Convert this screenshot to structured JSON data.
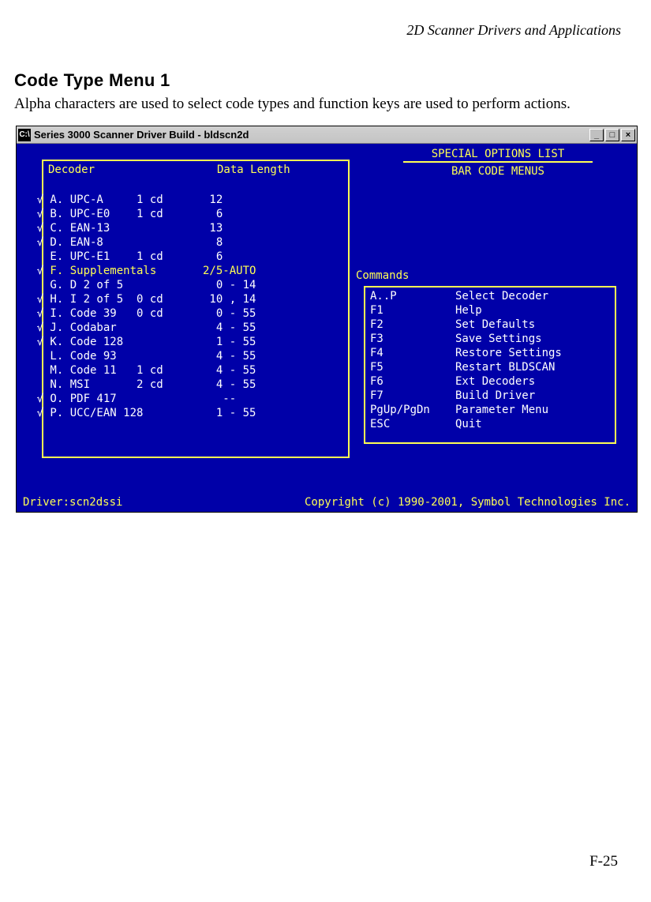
{
  "page": {
    "running_head": "2D Scanner Drivers and Applications",
    "section_title": "Code Type Menu 1",
    "intro": "Alpha characters are used to select code types and function keys are used to perform actions.",
    "page_number": "F-25"
  },
  "window": {
    "sys_icon": "C:\\",
    "title": "Series 3000 Scanner Driver Build - bldscn2d",
    "min_label": "_",
    "max_label": "□",
    "close_label": "×"
  },
  "screen": {
    "opt_title": "SPECIAL OPTIONS LIST",
    "opt_sub": "BAR CODE MENUS",
    "decoder_header_1": "Decoder",
    "decoder_header_2": "Data Length",
    "commands_label": "Commands",
    "driver_label": "Driver:",
    "driver_name": "scn2dssi",
    "copyright": "Copyright (c) 1990-2001, Symbol Technologies Inc."
  },
  "decoders": [
    {
      "ck": "√",
      "name": "A. UPC-A     1 cd",
      "len": " 12"
    },
    {
      "ck": "√",
      "name": "B. UPC-E0    1 cd",
      "len": "  6"
    },
    {
      "ck": "√",
      "name": "C. EAN-13",
      "len": " 13"
    },
    {
      "ck": "√",
      "name": "D. EAN-8",
      "len": "  8"
    },
    {
      "ck": " ",
      "name": "E. UPC-E1    1 cd",
      "len": "  6"
    },
    {
      "ck": "√",
      "name": "F. Supplementals",
      "len": "2/5-AUTO",
      "yellow": true
    },
    {
      "ck": " ",
      "name": "G. D 2 of 5",
      "len": "  0 - 14"
    },
    {
      "ck": "√",
      "name": "H. I 2 of 5  0 cd",
      "len": " 10 , 14"
    },
    {
      "ck": "√",
      "name": "I. Code 39   0 cd",
      "len": "  0 - 55"
    },
    {
      "ck": "√",
      "name": "J. Codabar",
      "len": "  4 - 55"
    },
    {
      "ck": "√",
      "name": "K. Code 128",
      "len": "  1 - 55"
    },
    {
      "ck": " ",
      "name": "L. Code 93",
      "len": "  4 - 55"
    },
    {
      "ck": " ",
      "name": "M. Code 11   1 cd",
      "len": "  4 - 55"
    },
    {
      "ck": " ",
      "name": "N. MSI       2 cd",
      "len": "  4 - 55"
    },
    {
      "ck": "√",
      "name": "O. PDF 417",
      "len": "   --"
    },
    {
      "ck": "√",
      "name": "P. UCC/EAN 128",
      "len": "  1 - 55"
    }
  ],
  "commands": [
    {
      "key": "A..P",
      "action": "Select Decoder"
    },
    {
      "key": "F1",
      "action": "Help"
    },
    {
      "key": "F2",
      "action": "Set Defaults"
    },
    {
      "key": "F3",
      "action": "Save Settings"
    },
    {
      "key": "F4",
      "action": "Restore Settings"
    },
    {
      "key": "F5",
      "action": "Restart BLDSCAN"
    },
    {
      "key": "F6",
      "action": "Ext Decoders"
    },
    {
      "key": "F7",
      "action": "Build Driver"
    },
    {
      "key": "PgUp/PgDn",
      "action": "Parameter Menu"
    },
    {
      "key": "ESC",
      "action": "Quit"
    }
  ]
}
